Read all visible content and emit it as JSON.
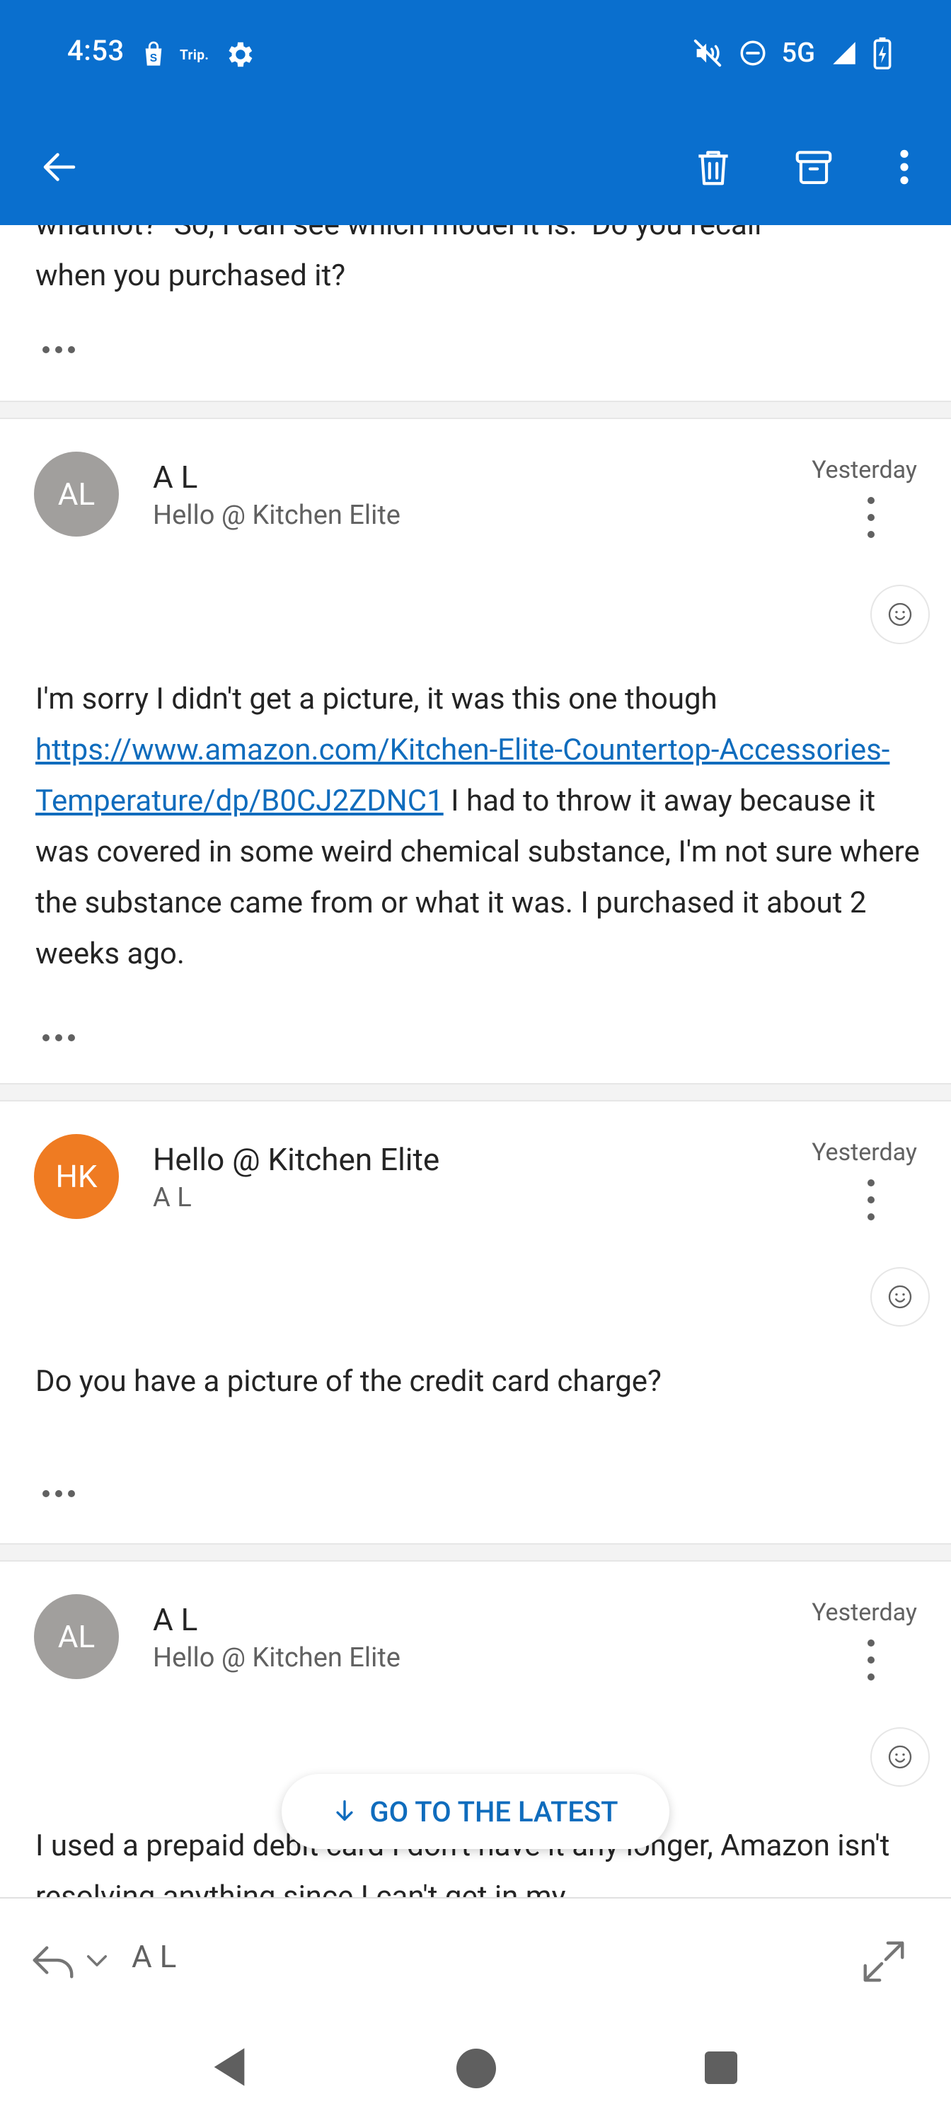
{
  "status_bar": {
    "time": "4:53",
    "trip_label": "Trip.",
    "network": "5G"
  },
  "toolbar": {
    "back_icon": "arrow-left-icon",
    "delete_icon": "trash-icon",
    "archive_icon": "archive-icon",
    "more_icon": "more-vertical-icon"
  },
  "previous_message": {
    "text_partial": "whatnot?\" So, I can see which model it is.\" Do you recall",
    "text": "when you purchased it?"
  },
  "messages": [
    {
      "avatar_initials": "AL",
      "avatar_color": "#a19f9d",
      "sender": "A L",
      "recipient": "Hello @ Kitchen Elite",
      "time": "Yesterday",
      "body_before_link": "I'm sorry I didn't get a picture, it was this one though ",
      "link_text": "https://www.amazon.com/Kitchen-Elite-Countertop-Accessories-Temperature/dp/B0CJ2ZDNC1",
      "body_after_link": " I had to throw it away because it was covered in some weird chemical substance, I'm not sure where the substance came from or what it was. I purchased it about 2 weeks ago."
    },
    {
      "avatar_initials": "HK",
      "avatar_color": "#ef7b22",
      "sender": "Hello @ Kitchen Elite",
      "recipient": "A L",
      "time": "Yesterday",
      "body": "Do you have a picture of the credit card charge?"
    },
    {
      "avatar_initials": "AL",
      "avatar_color": "#a19f9d",
      "sender": "A L",
      "recipient": "Hello @ Kitchen Elite",
      "time": "Yesterday",
      "body": "I used a prepaid debit card I don't have it any longer, Amazon isn't resolving anything since I can't get in my"
    }
  ],
  "go_to_latest": "GO TO THE LATEST",
  "reply_bar": {
    "to": "A L"
  },
  "colors": {
    "app_blue": "#0a6fce",
    "link": "#0f6cbd"
  }
}
